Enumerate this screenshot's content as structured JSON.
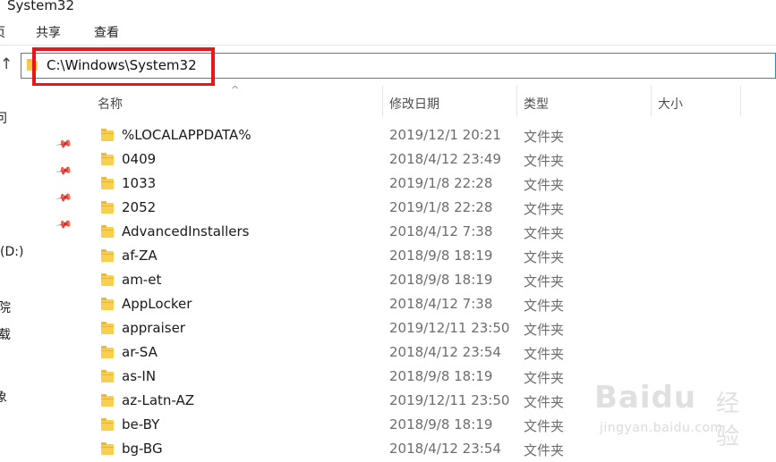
{
  "window": {
    "title": "System32"
  },
  "ribbon": {
    "tabs": [
      "页",
      "共享",
      "查看"
    ]
  },
  "address": {
    "path": "C:\\Windows\\System32"
  },
  "nav": {
    "fragments": [
      "问",
      "(D:)",
      "院",
      "载",
      "象"
    ]
  },
  "columns": {
    "name": "名称",
    "date": "修改日期",
    "type": "类型",
    "size": "大小"
  },
  "files": [
    {
      "name": "%LOCALAPPDATA%",
      "date": "2019/12/1 20:21",
      "type": "文件夹"
    },
    {
      "name": "0409",
      "date": "2018/4/12 23:49",
      "type": "文件夹"
    },
    {
      "name": "1033",
      "date": "2019/1/8 22:28",
      "type": "文件夹"
    },
    {
      "name": "2052",
      "date": "2019/1/8 22:28",
      "type": "文件夹"
    },
    {
      "name": "AdvancedInstallers",
      "date": "2018/4/12 7:38",
      "type": "文件夹"
    },
    {
      "name": "af-ZA",
      "date": "2018/9/8 18:19",
      "type": "文件夹"
    },
    {
      "name": "am-et",
      "date": "2018/9/8 18:19",
      "type": "文件夹"
    },
    {
      "name": "AppLocker",
      "date": "2018/4/12 7:38",
      "type": "文件夹"
    },
    {
      "name": "appraiser",
      "date": "2019/12/11 23:50",
      "type": "文件夹"
    },
    {
      "name": "ar-SA",
      "date": "2018/4/12 23:54",
      "type": "文件夹"
    },
    {
      "name": "as-IN",
      "date": "2018/9/8 18:19",
      "type": "文件夹"
    },
    {
      "name": "az-Latn-AZ",
      "date": "2019/12/11 23:50",
      "type": "文件夹"
    },
    {
      "name": "be-BY",
      "date": "2018/9/8 18:19",
      "type": "文件夹"
    },
    {
      "name": "bg-BG",
      "date": "2018/4/12 23:54",
      "type": "文件夹"
    }
  ],
  "watermark": {
    "logo": "Baidu",
    "cn": "经验",
    "url": "jingyan.baidu.com"
  }
}
